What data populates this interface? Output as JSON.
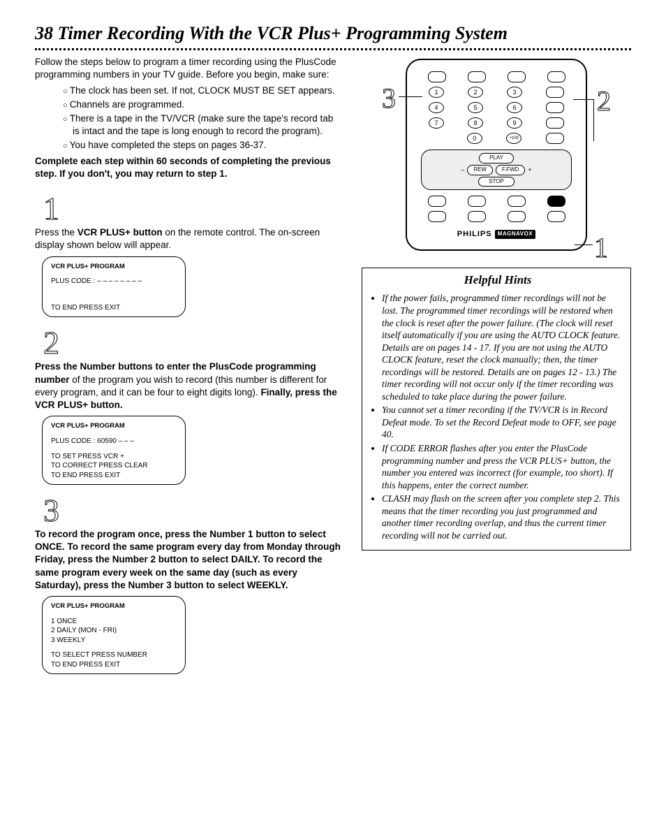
{
  "page": {
    "number": "38",
    "title": "Timer Recording With the VCR Plus+ Programming System"
  },
  "intro": {
    "lead": "Follow the steps below to program a timer recording using the PlusCode programming numbers in your TV guide. Before you begin, make sure:",
    "bullets": [
      "The clock has been set. If not, CLOCK MUST BE SET appears.",
      "Channels are programmed.",
      "There is a tape in the TV/VCR (make sure the tape's record tab is intact and the tape is long enough to record the program).",
      "You have completed the steps on pages 36-37."
    ],
    "complete_note": "Complete each step within 60 seconds of completing the previous step. If you don't, you may return to step 1."
  },
  "steps": [
    {
      "num": "1",
      "body_pre": "Press the ",
      "body_bold1": "VCR PLUS+ button",
      "body_post": " on the remote control. The on-screen display shown below will appear.",
      "osd": {
        "title": "VCR PLUS+ PROGRAM",
        "line1": "PLUS CODE : – – – – – – – –",
        "footer": "TO END PRESS EXIT"
      }
    },
    {
      "num": "2",
      "body_pre": "Press the Number buttons to enter the PlusCode programming number",
      "body_mid": " of the program you wish to record (this number is different for every program, and it can be four to eight digits long). ",
      "body_bold2": "Finally, press the VCR PLUS+ button.",
      "osd": {
        "title": "VCR PLUS+ PROGRAM",
        "line1": "PLUS CODE : 60590 – – –",
        "footer1": "TO SET PRESS VCR +",
        "footer2": "TO CORRECT PRESS CLEAR",
        "footer3": "TO END PRESS EXIT"
      }
    },
    {
      "num": "3",
      "body": "To record the program once, press the Number 1 button to select ONCE. To record the same program every day from Monday through Friday, press the Number 2 button to select DAILY. To record the same program every week on the same day (such as every Saturday), press the Number 3 button to select WEEKLY.",
      "osd": {
        "title": "VCR PLUS+ PROGRAM",
        "line1": "1 ONCE",
        "line2": "2 DAILY (MON - FRI)",
        "line3": "3 WEEKLY",
        "footer1": "TO SELECT PRESS NUMBER",
        "footer2": "TO END PRESS EXIT"
      }
    }
  ],
  "remote": {
    "callout_left": "3",
    "callout_right": "2",
    "callout_bottom": "1",
    "brand": "PHILIPS",
    "brand_box": "MAGNAVOX",
    "transport": {
      "play": "PLAY",
      "rew": "REW",
      "ffwd": "F.FWD",
      "stop": "STOP"
    },
    "numbers": [
      "1",
      "2",
      "3",
      "4",
      "5",
      "6",
      "7",
      "8",
      "9",
      "0",
      "+100"
    ]
  },
  "hints": {
    "title": "Helpful Hints",
    "items": [
      "If the power fails, programmed timer recordings will not be lost. The programmed timer recordings will be restored when the clock is reset after the power failure. (The clock will reset itself automatically if you are using the AUTO CLOCK feature. Details are on pages 14 - 17. If you are not using the AUTO CLOCK feature, reset the clock manually; then, the timer recordings will be restored. Details are on pages 12 - 13.) The timer recording will not occur only if the timer recording was scheduled to take place during the power failure.",
      "You cannot set a timer recording if the TV/VCR is in Record Defeat mode. To set the Record Defeat mode to OFF, see page 40.",
      "If CODE ERROR flashes after you enter the PlusCode programming number and press the VCR PLUS+ button, the number you entered was incorrect (for example, too short). If this happens, enter the correct number.",
      "CLASH may flash on the screen after you complete step 2. This means that the timer recording you just programmed and another timer recording overlap, and thus the current timer recording will not be carried out."
    ]
  }
}
